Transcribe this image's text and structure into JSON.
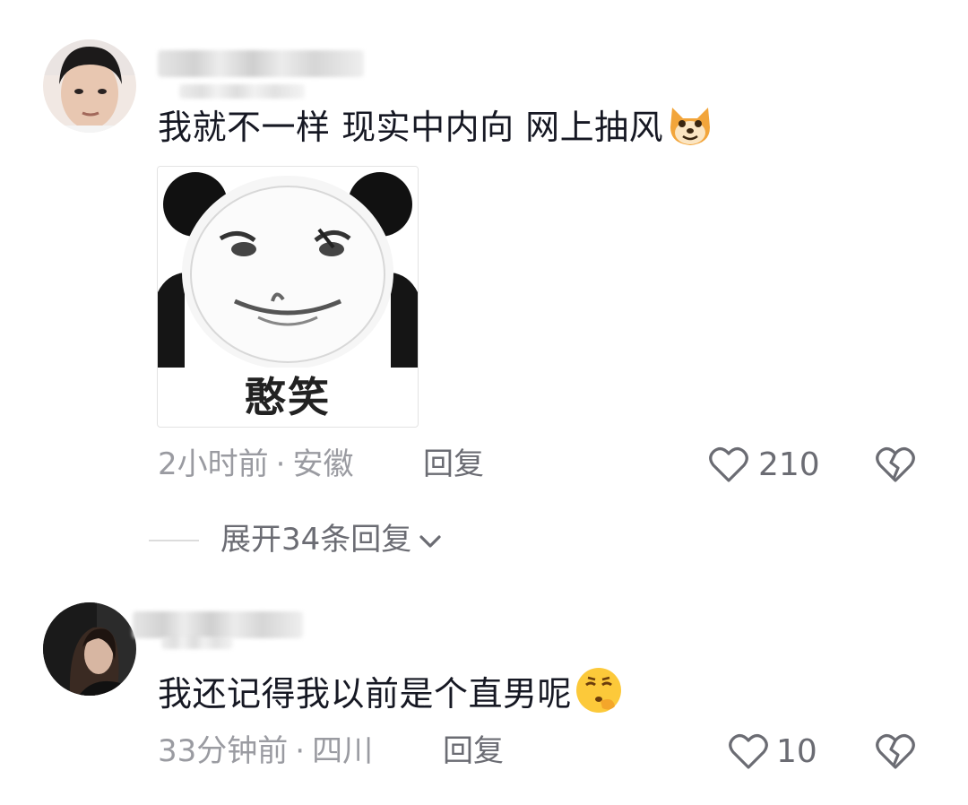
{
  "comments": [
    {
      "text": "我就不一样 现实中内向 网上抽风",
      "emoji": "doge-emoji",
      "sticker_caption": "憨笑",
      "time": "2小时前",
      "separator": "·",
      "location": "安徽",
      "reply_label": "回复",
      "likes": "210"
    },
    {
      "text": "我还记得我以前是个直男呢",
      "emoji": "smirk-face-emoji",
      "time": "33分钟前",
      "separator": "·",
      "location": "四川",
      "reply_label": "回复",
      "likes": "10"
    }
  ],
  "expand_replies": "展开34条回复",
  "icons": {
    "like": "heart-outline-icon",
    "dislike": "broken-heart-icon",
    "expand": "chevron-down-icon"
  }
}
